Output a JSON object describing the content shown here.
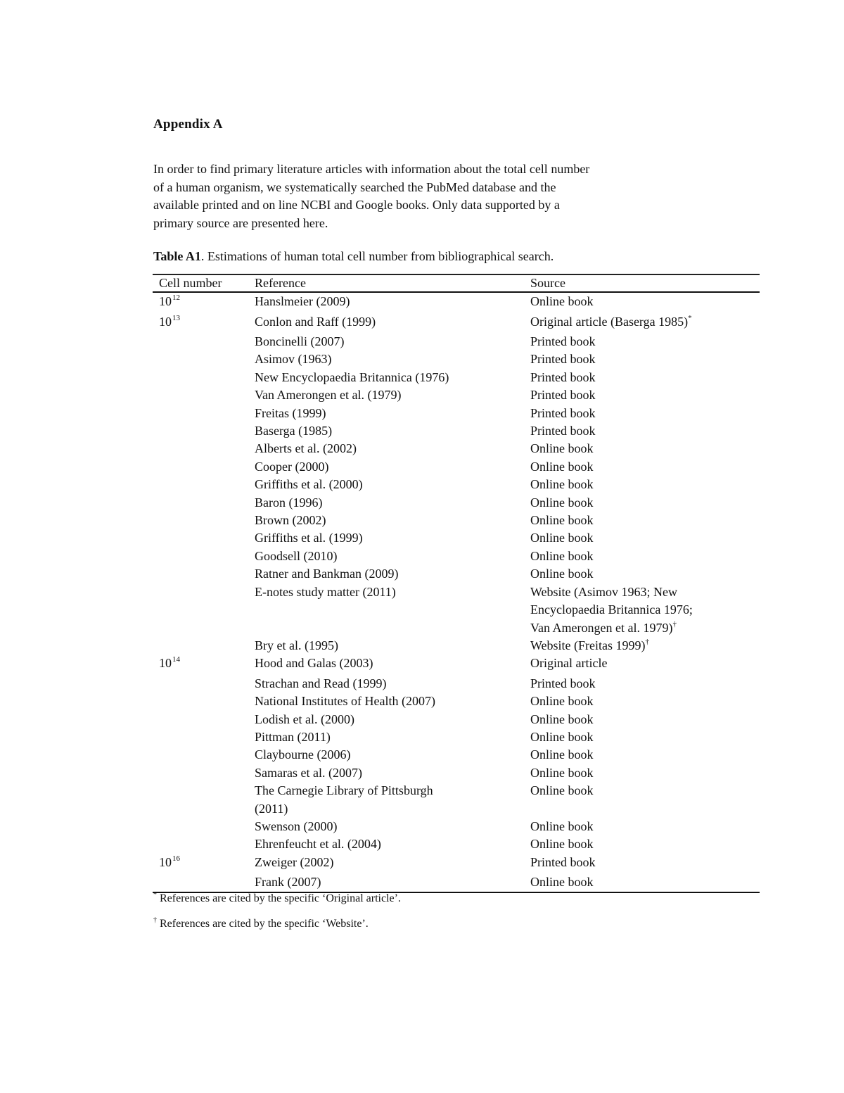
{
  "appendix": {
    "heading": "Appendix A",
    "intro_lines": [
      "In order to find primary literature articles with information about the total cell number",
      "of a human organism, we systematically searched the PubMed database and the",
      "available printed and on line NCBI and Google books. Only data supported by a",
      "primary source are presented here."
    ]
  },
  "table": {
    "caption_label": "Table A1",
    "caption_text": ". Estimations of human total cell number from bibliographical search.",
    "columns": [
      "Cell number",
      "Reference",
      "Source"
    ],
    "rows": [
      {
        "base": "10",
        "exp": "12",
        "reference": [
          "Hanslmeier (2009)"
        ],
        "source": [
          "Online book"
        ],
        "mark": ""
      },
      {
        "base": "10",
        "exp": "13",
        "reference": [
          "Conlon and Raff (1999)"
        ],
        "source": [
          "Original article (Baserga 1985)"
        ],
        "mark": "*"
      },
      {
        "base": "",
        "exp": "",
        "reference": [
          "Boncinelli (2007)"
        ],
        "source": [
          "Printed book"
        ],
        "mark": ""
      },
      {
        "base": "",
        "exp": "",
        "reference": [
          "Asimov (1963)"
        ],
        "source": [
          "Printed book"
        ],
        "mark": ""
      },
      {
        "base": "",
        "exp": "",
        "reference": [
          "New Encyclopaedia Britannica (1976)"
        ],
        "source": [
          "Printed book"
        ],
        "mark": ""
      },
      {
        "base": "",
        "exp": "",
        "reference": [
          "Van Amerongen et al. (1979)"
        ],
        "source": [
          "Printed book"
        ],
        "mark": ""
      },
      {
        "base": "",
        "exp": "",
        "reference": [
          "Freitas (1999)"
        ],
        "source": [
          "Printed book"
        ],
        "mark": ""
      },
      {
        "base": "",
        "exp": "",
        "reference": [
          "Baserga (1985)"
        ],
        "source": [
          "Printed book"
        ],
        "mark": ""
      },
      {
        "base": "",
        "exp": "",
        "reference": [
          "Alberts et al. (2002)"
        ],
        "source": [
          "Online book"
        ],
        "mark": ""
      },
      {
        "base": "",
        "exp": "",
        "reference": [
          "Cooper (2000)"
        ],
        "source": [
          "Online book"
        ],
        "mark": ""
      },
      {
        "base": "",
        "exp": "",
        "reference": [
          "Griffiths et al. (2000)"
        ],
        "source": [
          "Online book"
        ],
        "mark": ""
      },
      {
        "base": "",
        "exp": "",
        "reference": [
          "Baron (1996)"
        ],
        "source": [
          "Online book"
        ],
        "mark": ""
      },
      {
        "base": "",
        "exp": "",
        "reference": [
          "Brown (2002)"
        ],
        "source": [
          "Online book"
        ],
        "mark": ""
      },
      {
        "base": "",
        "exp": "",
        "reference": [
          "Griffiths et al. (1999)"
        ],
        "source": [
          "Online book"
        ],
        "mark": ""
      },
      {
        "base": "",
        "exp": "",
        "reference": [
          "Goodsell (2010)"
        ],
        "source": [
          "Online book"
        ],
        "mark": ""
      },
      {
        "base": "",
        "exp": "",
        "reference": [
          "Ratner and Bankman (2009)"
        ],
        "source": [
          "Online book"
        ],
        "mark": ""
      },
      {
        "base": "",
        "exp": "",
        "reference": [
          "E-notes study matter (2011)"
        ],
        "source": [
          "Website (Asimov 1963; New",
          "Encyclopaedia Britannica 1976;",
          "Van Amerongen et al. 1979)"
        ],
        "mark": "†"
      },
      {
        "base": "",
        "exp": "",
        "reference": [
          "Bry et al. (1995)"
        ],
        "source": [
          "Website (Freitas 1999)"
        ],
        "mark": "†"
      },
      {
        "base": "10",
        "exp": "14",
        "reference": [
          "Hood and Galas (2003)"
        ],
        "source": [
          "Original article"
        ],
        "mark": ""
      },
      {
        "base": "",
        "exp": "",
        "reference": [
          "Strachan and Read (1999)"
        ],
        "source": [
          "Printed book"
        ],
        "mark": ""
      },
      {
        "base": "",
        "exp": "",
        "reference": [
          "National Institutes of Health (2007)"
        ],
        "source": [
          "Online book"
        ],
        "mark": ""
      },
      {
        "base": "",
        "exp": "",
        "reference": [
          "Lodish et al. (2000)"
        ],
        "source": [
          "Online book"
        ],
        "mark": ""
      },
      {
        "base": "",
        "exp": "",
        "reference": [
          "Pittman (2011)"
        ],
        "source": [
          "Online book"
        ],
        "mark": ""
      },
      {
        "base": "",
        "exp": "",
        "reference": [
          "Claybourne (2006)"
        ],
        "source": [
          "Online book"
        ],
        "mark": ""
      },
      {
        "base": "",
        "exp": "",
        "reference": [
          "Samaras et al. (2007)"
        ],
        "source": [
          "Online book"
        ],
        "mark": ""
      },
      {
        "base": "",
        "exp": "",
        "reference": [
          "The Carnegie Library of Pittsburgh",
          "(2011)"
        ],
        "source": [
          "Online book"
        ],
        "mark": ""
      },
      {
        "base": "",
        "exp": "",
        "reference": [
          "Swenson (2000)"
        ],
        "source": [
          "Online book"
        ],
        "mark": ""
      },
      {
        "base": "",
        "exp": "",
        "reference": [
          "Ehrenfeucht et al. (2004)"
        ],
        "source": [
          "Online book"
        ],
        "mark": ""
      },
      {
        "base": "10",
        "exp": "16",
        "reference": [
          "Zweiger (2002)"
        ],
        "source": [
          "Printed book"
        ],
        "mark": ""
      },
      {
        "base": "",
        "exp": "",
        "reference": [
          "Frank (2007)"
        ],
        "source": [
          "Online book"
        ],
        "mark": ""
      }
    ]
  },
  "footnotes": [
    {
      "mark": "*",
      "text": " References are cited by the specific ‘Original article’."
    },
    {
      "mark": "†",
      "text": " References are cited by the specific ‘Website’."
    }
  ]
}
